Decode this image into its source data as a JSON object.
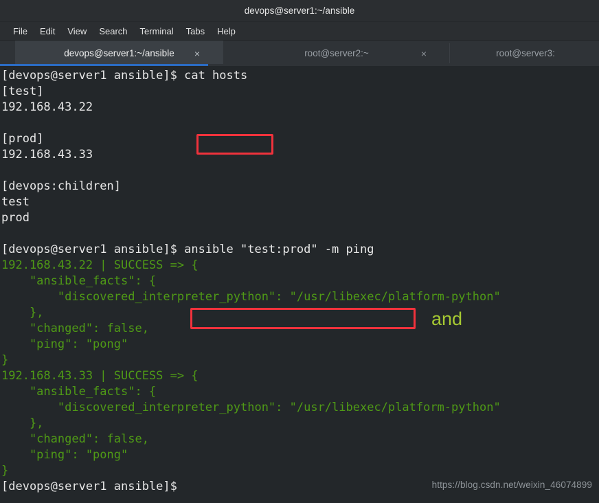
{
  "window": {
    "title": "devops@server1:~/ansible"
  },
  "menubar": {
    "items": [
      {
        "label": "File"
      },
      {
        "label": "Edit"
      },
      {
        "label": "View"
      },
      {
        "label": "Search"
      },
      {
        "label": "Terminal"
      },
      {
        "label": "Tabs"
      },
      {
        "label": "Help"
      }
    ]
  },
  "tabs": [
    {
      "label": "devops@server1:~/ansible",
      "close": "×",
      "active": true
    },
    {
      "label": "root@server2:~",
      "close": "×",
      "active": false
    },
    {
      "label": "root@server3:",
      "close": "",
      "active": false
    }
  ],
  "terminal": {
    "lines": [
      {
        "text": "[devops@server1 ansible]$ cat hosts",
        "color": "default"
      },
      {
        "text": "[test]",
        "color": "default"
      },
      {
        "text": "192.168.43.22",
        "color": "default"
      },
      {
        "text": "",
        "color": "blank"
      },
      {
        "text": "[prod]",
        "color": "default"
      },
      {
        "text": "192.168.43.33",
        "color": "default"
      },
      {
        "text": "",
        "color": "blank"
      },
      {
        "text": "[devops:children]",
        "color": "default"
      },
      {
        "text": "test",
        "color": "default"
      },
      {
        "text": "prod",
        "color": "default"
      },
      {
        "text": "",
        "color": "blank"
      },
      {
        "text": "[devops@server1 ansible]$ ansible \"test:prod\" -m ping",
        "color": "default"
      },
      {
        "text": "192.168.43.22 | SUCCESS => {",
        "color": "green"
      },
      {
        "text": "    \"ansible_facts\": {",
        "color": "green"
      },
      {
        "text": "        \"discovered_interpreter_python\": \"/usr/libexec/platform-python\"",
        "color": "green"
      },
      {
        "text": "    },",
        "color": "green"
      },
      {
        "text": "    \"changed\": false,",
        "color": "green"
      },
      {
        "text": "    \"ping\": \"pong\"",
        "color": "green"
      },
      {
        "text": "}",
        "color": "green"
      },
      {
        "text": "192.168.43.33 | SUCCESS => {",
        "color": "green"
      },
      {
        "text": "    \"ansible_facts\": {",
        "color": "green"
      },
      {
        "text": "        \"discovered_interpreter_python\": \"/usr/libexec/platform-python\"",
        "color": "green"
      },
      {
        "text": "    },",
        "color": "green"
      },
      {
        "text": "    \"changed\": false,",
        "color": "green"
      },
      {
        "text": "    \"ping\": \"pong\"",
        "color": "green"
      },
      {
        "text": "}",
        "color": "green"
      },
      {
        "text": "[devops@server1 ansible]$",
        "color": "default"
      }
    ]
  },
  "annotations": {
    "box_cat_hosts": {
      "label": "cat hosts"
    },
    "box_ansible_ping": {
      "label": "ansible \"test:prod\" -m ping"
    },
    "and_note": {
      "label": "and"
    },
    "accent_red": "#f0323c",
    "accent_green": "#a6c932"
  },
  "watermark": {
    "text": "https://blog.csdn.net/weixin_46074899"
  }
}
